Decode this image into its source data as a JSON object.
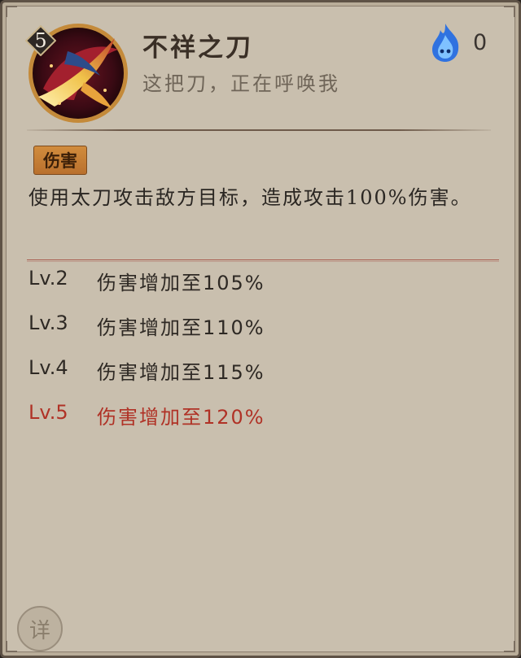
{
  "skill": {
    "name": "不祥之刀",
    "subtitle": "这把刀，正在呼唤我",
    "level": "5",
    "icon": "crimson-blade-swirl-icon"
  },
  "resource": {
    "icon": "blue-ghost-fire-icon",
    "count": "0"
  },
  "tag": {
    "label": "伤害",
    "color": "#c07a32"
  },
  "description": "使用太刀攻击敌方目标，造成攻击100%伤害。",
  "level_effects": [
    {
      "level": "Lv.2",
      "effect": "伤害增加至105%",
      "active": false
    },
    {
      "level": "Lv.3",
      "effect": "伤害增加至110%",
      "active": false
    },
    {
      "level": "Lv.4",
      "effect": "伤害增加至115%",
      "active": false
    },
    {
      "level": "Lv.5",
      "effect": "伤害增加至120%",
      "active": true
    }
  ],
  "detail_button": {
    "label": "详"
  },
  "colors": {
    "panel": "#c9bfae",
    "active_level": "#b03226",
    "text": "#2e2924"
  }
}
